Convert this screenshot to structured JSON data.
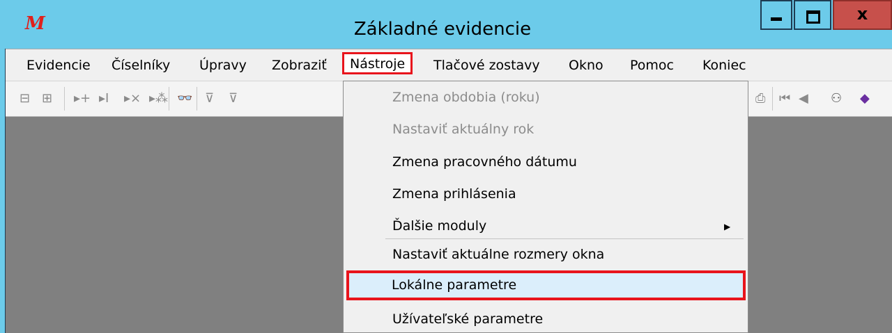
{
  "window": {
    "title": "Základné evidencie",
    "app_icon_glyph": "M",
    "minimize_icon": "minimize-icon",
    "maximize_icon": "maximize-icon",
    "close_glyph": "x"
  },
  "menubar": {
    "items": [
      {
        "label": "Evidencie"
      },
      {
        "label": "Číselníky"
      },
      {
        "label": "Úpravy"
      },
      {
        "label": "Zobraziť"
      },
      {
        "label": "Nástroje",
        "active": true
      },
      {
        "label": "Tlačové zostavy"
      },
      {
        "label": "Okno"
      },
      {
        "label": "Pomoc"
      },
      {
        "label": "Koniec"
      }
    ]
  },
  "toolbar": {
    "icons": [
      "collapse-icon",
      "expand-icon",
      "add-record-icon",
      "insert-record-icon",
      "delete-record-icon",
      "copy-record-icon",
      "find-icon",
      "filter-icon",
      "filter-edit-icon",
      "print-icon",
      "first-record-icon",
      "prev-record-icon",
      "search-people-icon",
      "help-book-icon"
    ],
    "glyphs": {
      "collapse": "⊟",
      "expand": "⊞",
      "add": "▸+",
      "insert": "▸I",
      "delete": "▸×",
      "copy": "▸⁂",
      "find": "👓",
      "filter": "⊽",
      "filter2": "⊽",
      "print": "⎙",
      "first": "⏮",
      "prev": "◀",
      "people": "⚇",
      "help": "◆"
    }
  },
  "dropdown": {
    "items": [
      {
        "label": "Zmena obdobia (roku)",
        "disabled": true
      },
      {
        "label": "Nastaviť aktuálny rok",
        "disabled": true
      },
      {
        "label": "Zmena pracovného dátumu",
        "disabled": false
      },
      {
        "label": "Zmena prihlásenia",
        "disabled": false
      },
      {
        "label": "Ďalšie moduly",
        "disabled": false,
        "submenu": true,
        "arrow": "▶"
      },
      {
        "label": "Nastaviť aktuálne rozmery okna",
        "disabled": false
      },
      {
        "label": "Lokálne parametre",
        "disabled": false,
        "selected": true
      },
      {
        "label": "Užívateľské parametre",
        "disabled": false
      }
    ]
  },
  "colors": {
    "titlebar": "#6ccbea",
    "highlight_border": "#e8141c",
    "close_button": "#c7504b",
    "workspace": "#808080"
  }
}
